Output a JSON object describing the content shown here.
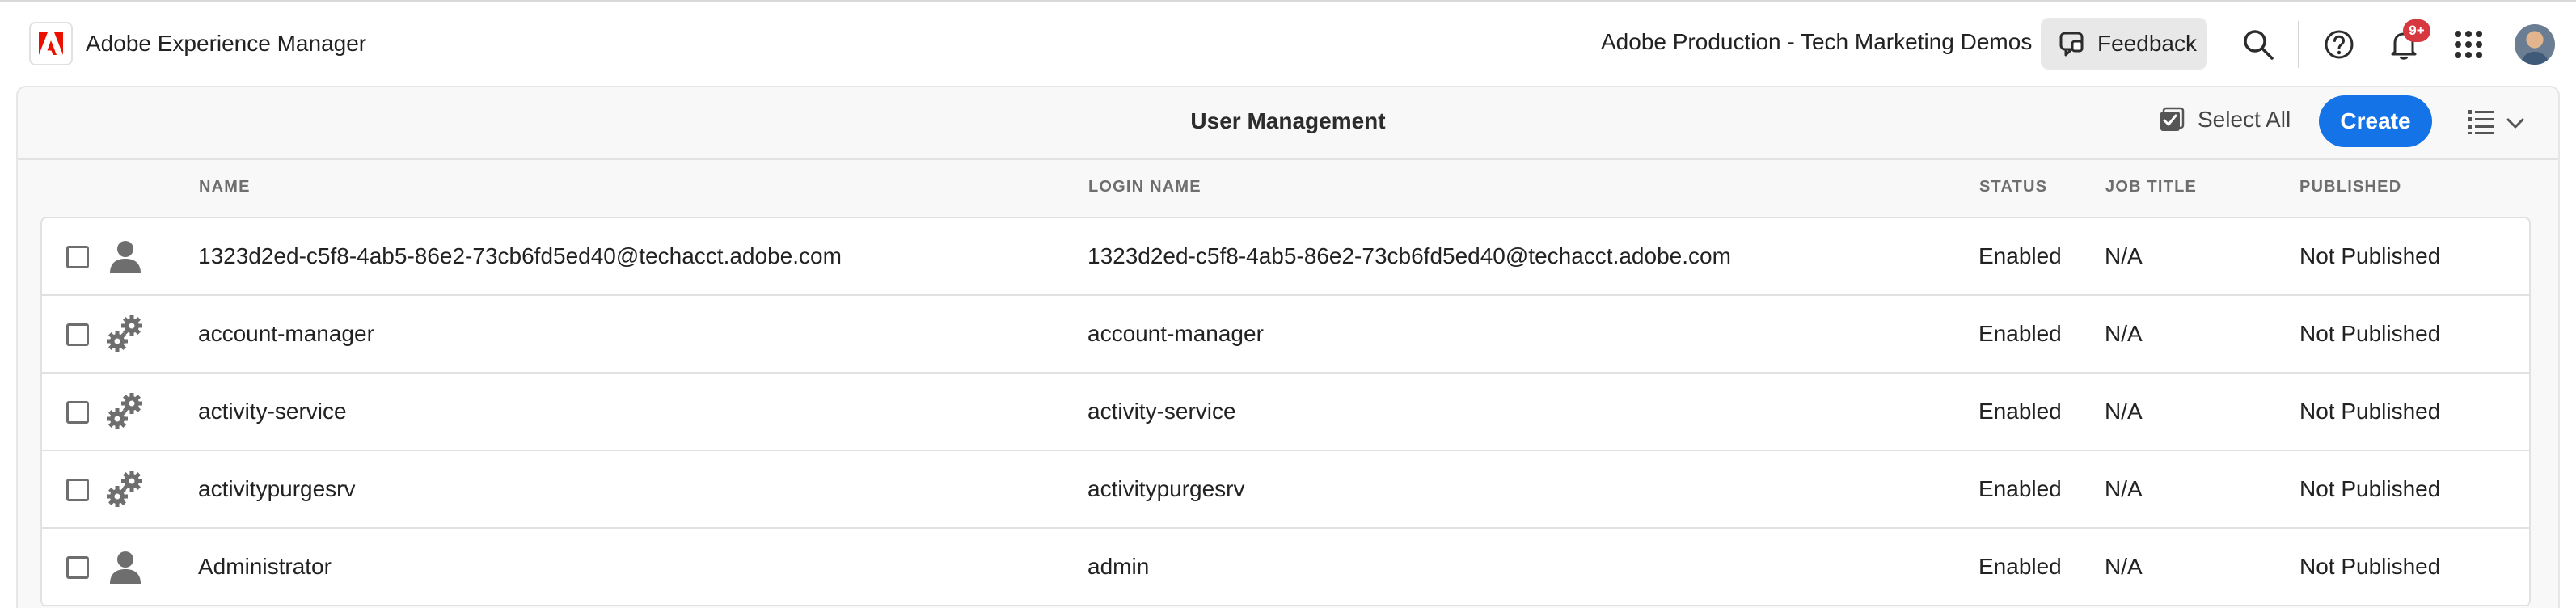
{
  "header": {
    "app_title": "Adobe Experience Manager",
    "org_name": "Adobe Production - Tech Marketing Demos",
    "feedback_label": "Feedback",
    "notification_count": "9+",
    "icons": [
      "adobe-logo-icon",
      "feedback-icon",
      "search-icon",
      "help-icon",
      "bell-icon",
      "app-grid-icon",
      "avatar"
    ]
  },
  "actionbar": {
    "title": "User Management",
    "select_all_label": "Select All",
    "create_label": "Create",
    "view_icon": "list-view-icon"
  },
  "table": {
    "columns": [
      "NAME",
      "LOGIN NAME",
      "STATUS",
      "JOB TITLE",
      "PUBLISHED"
    ],
    "rows": [
      {
        "type": "user",
        "name": "1323d2ed-c5f8-4ab5-86e2-73cb6fd5ed40@techacct.adobe.com",
        "login": "1323d2ed-c5f8-4ab5-86e2-73cb6fd5ed40@techacct.adobe.com",
        "status": "Enabled",
        "job_title": "N/A",
        "published": "Not Published"
      },
      {
        "type": "service",
        "name": "account-manager",
        "login": "account-manager",
        "status": "Enabled",
        "job_title": "N/A",
        "published": "Not Published"
      },
      {
        "type": "service",
        "name": "activity-service",
        "login": "activity-service",
        "status": "Enabled",
        "job_title": "N/A",
        "published": "Not Published"
      },
      {
        "type": "service",
        "name": "activitypurgesrv",
        "login": "activitypurgesrv",
        "status": "Enabled",
        "job_title": "N/A",
        "published": "Not Published"
      },
      {
        "type": "user",
        "name": "Administrator",
        "login": "admin",
        "status": "Enabled",
        "job_title": "N/A",
        "published": "Not Published"
      }
    ]
  },
  "colors": {
    "accent": "#1473e6",
    "badge": "#d7373f",
    "annotation": "#e0442c"
  }
}
